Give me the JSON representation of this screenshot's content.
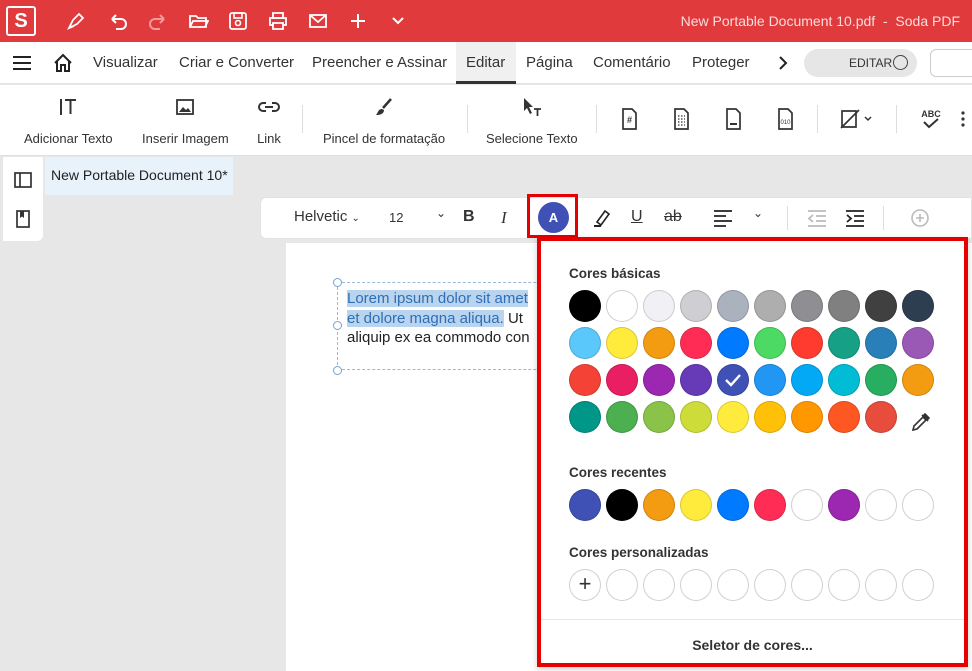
{
  "titlebar": {
    "logo": "S",
    "document_title": "New Portable Document 10.pdf",
    "app_name": "Soda PDF",
    "title_text": "New Portable Document 10.pdf  -  Soda PDF",
    "accent": "#e03a3c"
  },
  "menu": {
    "tabs": [
      "Visualizar",
      "Criar e Converter",
      "Preencher e Assinar",
      "Editar",
      "Página",
      "Comentário",
      "Proteger"
    ],
    "active_tab": "Editar",
    "edit_toggle": "EDITAR"
  },
  "ribbon": {
    "add_text": "Adicionar Texto",
    "insert_image": "Inserir Imagem",
    "link": "Link",
    "format_painter": "Pincel de formatação",
    "select_text": "Selecione Texto",
    "spellcheck": "ABC"
  },
  "doc_tab": "New Portable Document 10*",
  "format": {
    "font": "Helvetic",
    "size": "12",
    "bold": "B",
    "italic": "I",
    "underline": "U",
    "strike": "ab",
    "color_button": "A"
  },
  "document": {
    "line1": "Lorem ipsum dolor sit amet",
    "line2_selected": "et dolore magna aliqua.",
    "line2_rest": " Ut",
    "line3": "aliquip ex ea commodo con"
  },
  "palette": {
    "basic_title": "Cores básicas",
    "basic": [
      [
        "#000000",
        "#ffffff",
        "#f0f0f5",
        "#cfcfd3",
        "#aab2bd",
        "#aeaeae",
        "#8e8e93",
        "#808080",
        "#404040",
        "#2c3e50"
      ],
      [
        "#5ac8fa",
        "#ffeb3b",
        "#f39c12",
        "#ff2d55",
        "#007aff",
        "#4cd964",
        "#ff3b30",
        "#16a085",
        "#2980b9",
        "#9b59b6"
      ],
      [
        "#f44336",
        "#e91e63",
        "#9c27b0",
        "#673ab7",
        "#3f51b5",
        "#2196f3",
        "#03a9f4",
        "#00bcd4",
        "#27ae60",
        "#f39c12"
      ],
      [
        "#009688",
        "#4caf50",
        "#8bc34a",
        "#cddc39",
        "#ffeb3b",
        "#ffc107",
        "#ff9800",
        "#ff5722",
        "#e74c3c"
      ]
    ],
    "selected": "#3f51b5",
    "recent_title": "Cores recentes",
    "recent": [
      "#3f51b5",
      "#000000",
      "#f39c12",
      "#ffeb3b",
      "#007aff",
      "#ff2d55",
      "#ffffff",
      "#9c27b0",
      "#ffffff",
      "#ffffff"
    ],
    "custom_title": "Cores personalizadas",
    "add_symbol": "+",
    "picker_link": "Seletor de cores..."
  }
}
